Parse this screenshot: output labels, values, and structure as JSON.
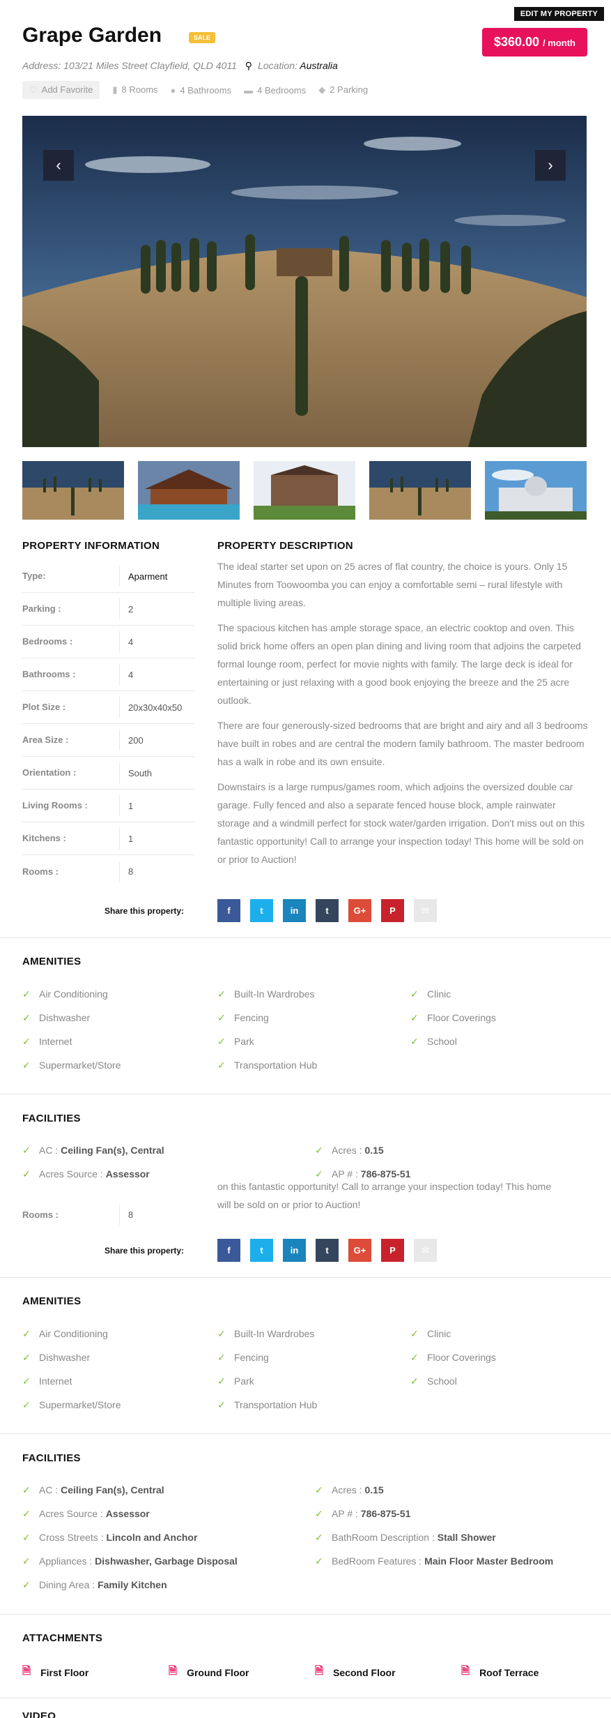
{
  "header": {
    "edit_label": "EDIT MY PROPERTY",
    "title": "Grape Garden",
    "badge": "SALE",
    "price": "$360.00",
    "price_period": "/ month",
    "address_label": "Address:",
    "address_value": "103/21 Miles Street Clayfield, QLD 4011",
    "location_label": "Location:",
    "location_value": "Australia"
  },
  "meta": {
    "favorite": "Add Favorite",
    "rooms": "8 Rooms",
    "bathrooms": "4 Bathrooms",
    "bedrooms": "4 Bedrooms",
    "parking": "2 Parking"
  },
  "gallery": {
    "prev": "‹",
    "next": "›"
  },
  "info": {
    "heading": "PROPERTY INFORMATION",
    "rows": [
      {
        "k": "Type:",
        "v": "Aparment"
      },
      {
        "k": "Parking :",
        "v": "2"
      },
      {
        "k": "Bedrooms :",
        "v": "4"
      },
      {
        "k": "Bathrooms :",
        "v": "4"
      },
      {
        "k": "Plot Size :",
        "v": "20x30x40x50"
      },
      {
        "k": "Area Size :",
        "v": "200"
      },
      {
        "k": "Orientation :",
        "v": "South"
      },
      {
        "k": "Living Rooms :",
        "v": "1"
      },
      {
        "k": "Kitchens :",
        "v": "1"
      },
      {
        "k": "Rooms :",
        "v": "8"
      }
    ]
  },
  "description": {
    "heading": "PROPERTY DESCRIPTION",
    "paragraphs": [
      "The ideal starter set upon on 25 acres of flat country, the choice is yours. Only 15 Minutes from Toowoomba you can enjoy a comfortable semi – rural lifestyle with multiple living areas.",
      "The spacious kitchen has ample storage space, an electric cooktop and oven. This solid brick home offers an open plan dining and living room that adjoins the carpeted formal lounge room, perfect for movie nights with family. The large deck is ideal for entertaining or just relaxing with a good book enjoying the breeze and the 25 acre outlook.",
      "There are four generously-sized bedrooms that are bright and airy and all 3 bedrooms have built in robes and are central the modern family bathroom. The master bedroom has a walk in robe and its own ensuite.",
      "Downstairs is a large rumpus/games room, which adjoins the oversized double car garage. Fully fenced and also a separate fenced house block, ample rainwater storage and a windmill perfect for stock water/garden irrigation. Don't miss out on this fantastic opportunity! Call to arrange your inspection today! This home will be sold on or prior to Auction!"
    ],
    "tail_line1": "on this fantastic opportunity! Call to arrange your inspection today! This home",
    "tail_line2": "will be sold on or prior to Auction!"
  },
  "share": {
    "label": "Share this property:",
    "buttons": [
      {
        "name": "facebook",
        "glyph": "f",
        "color": "#3b5998"
      },
      {
        "name": "twitter",
        "glyph": "t",
        "color": "#1dafec"
      },
      {
        "name": "linkedin",
        "glyph": "in",
        "color": "#1a84bc"
      },
      {
        "name": "tumblr",
        "glyph": "t",
        "color": "#35465c"
      },
      {
        "name": "google-plus",
        "glyph": "G+",
        "color": "#dd4b39"
      },
      {
        "name": "pinterest",
        "glyph": "P",
        "color": "#c8232c"
      },
      {
        "name": "email",
        "glyph": "✉",
        "color": "#e8e8e8"
      }
    ]
  },
  "amenities": {
    "heading": "AMENITIES",
    "items": [
      "Air Conditioning",
      "Built-In Wardrobes",
      "Clinic",
      "Dishwasher",
      "Fencing",
      "Floor Coverings",
      "Internet",
      "Park",
      "School",
      "Supermarket/Store",
      "Transportation Hub"
    ]
  },
  "facilities": {
    "heading": "FACILITIES",
    "short": [
      {
        "k": "AC :",
        "v": "Ceiling Fan(s), Central"
      },
      {
        "k": "Acres :",
        "v": "0.15"
      },
      {
        "k": "Acres Source :",
        "v": "Assessor"
      },
      {
        "k": "AP # :",
        "v": "786-875-51"
      }
    ],
    "full": [
      {
        "k": "AC :",
        "v": "Ceiling Fan(s), Central"
      },
      {
        "k": "Acres :",
        "v": "0.15"
      },
      {
        "k": "Acres Source :",
        "v": "Assessor"
      },
      {
        "k": "AP # :",
        "v": "786-875-51"
      },
      {
        "k": "Cross Streets :",
        "v": "Lincoln and Anchor"
      },
      {
        "k": "BathRoom Description :",
        "v": "Stall Shower"
      },
      {
        "k": "Appliances :",
        "v": "Dishwasher, Garbage Disposal"
      },
      {
        "k": "BedRoom Features :",
        "v": "Main Floor Master Bedroom"
      },
      {
        "k": "Dining Area :",
        "v": "Family Kitchen"
      }
    ]
  },
  "attachments": {
    "heading": "ATTACHMENTS",
    "files": [
      "First Floor",
      "Ground Floor",
      "Second Floor",
      "Roof Terrace"
    ]
  },
  "video": {
    "heading": "VIDEO"
  }
}
